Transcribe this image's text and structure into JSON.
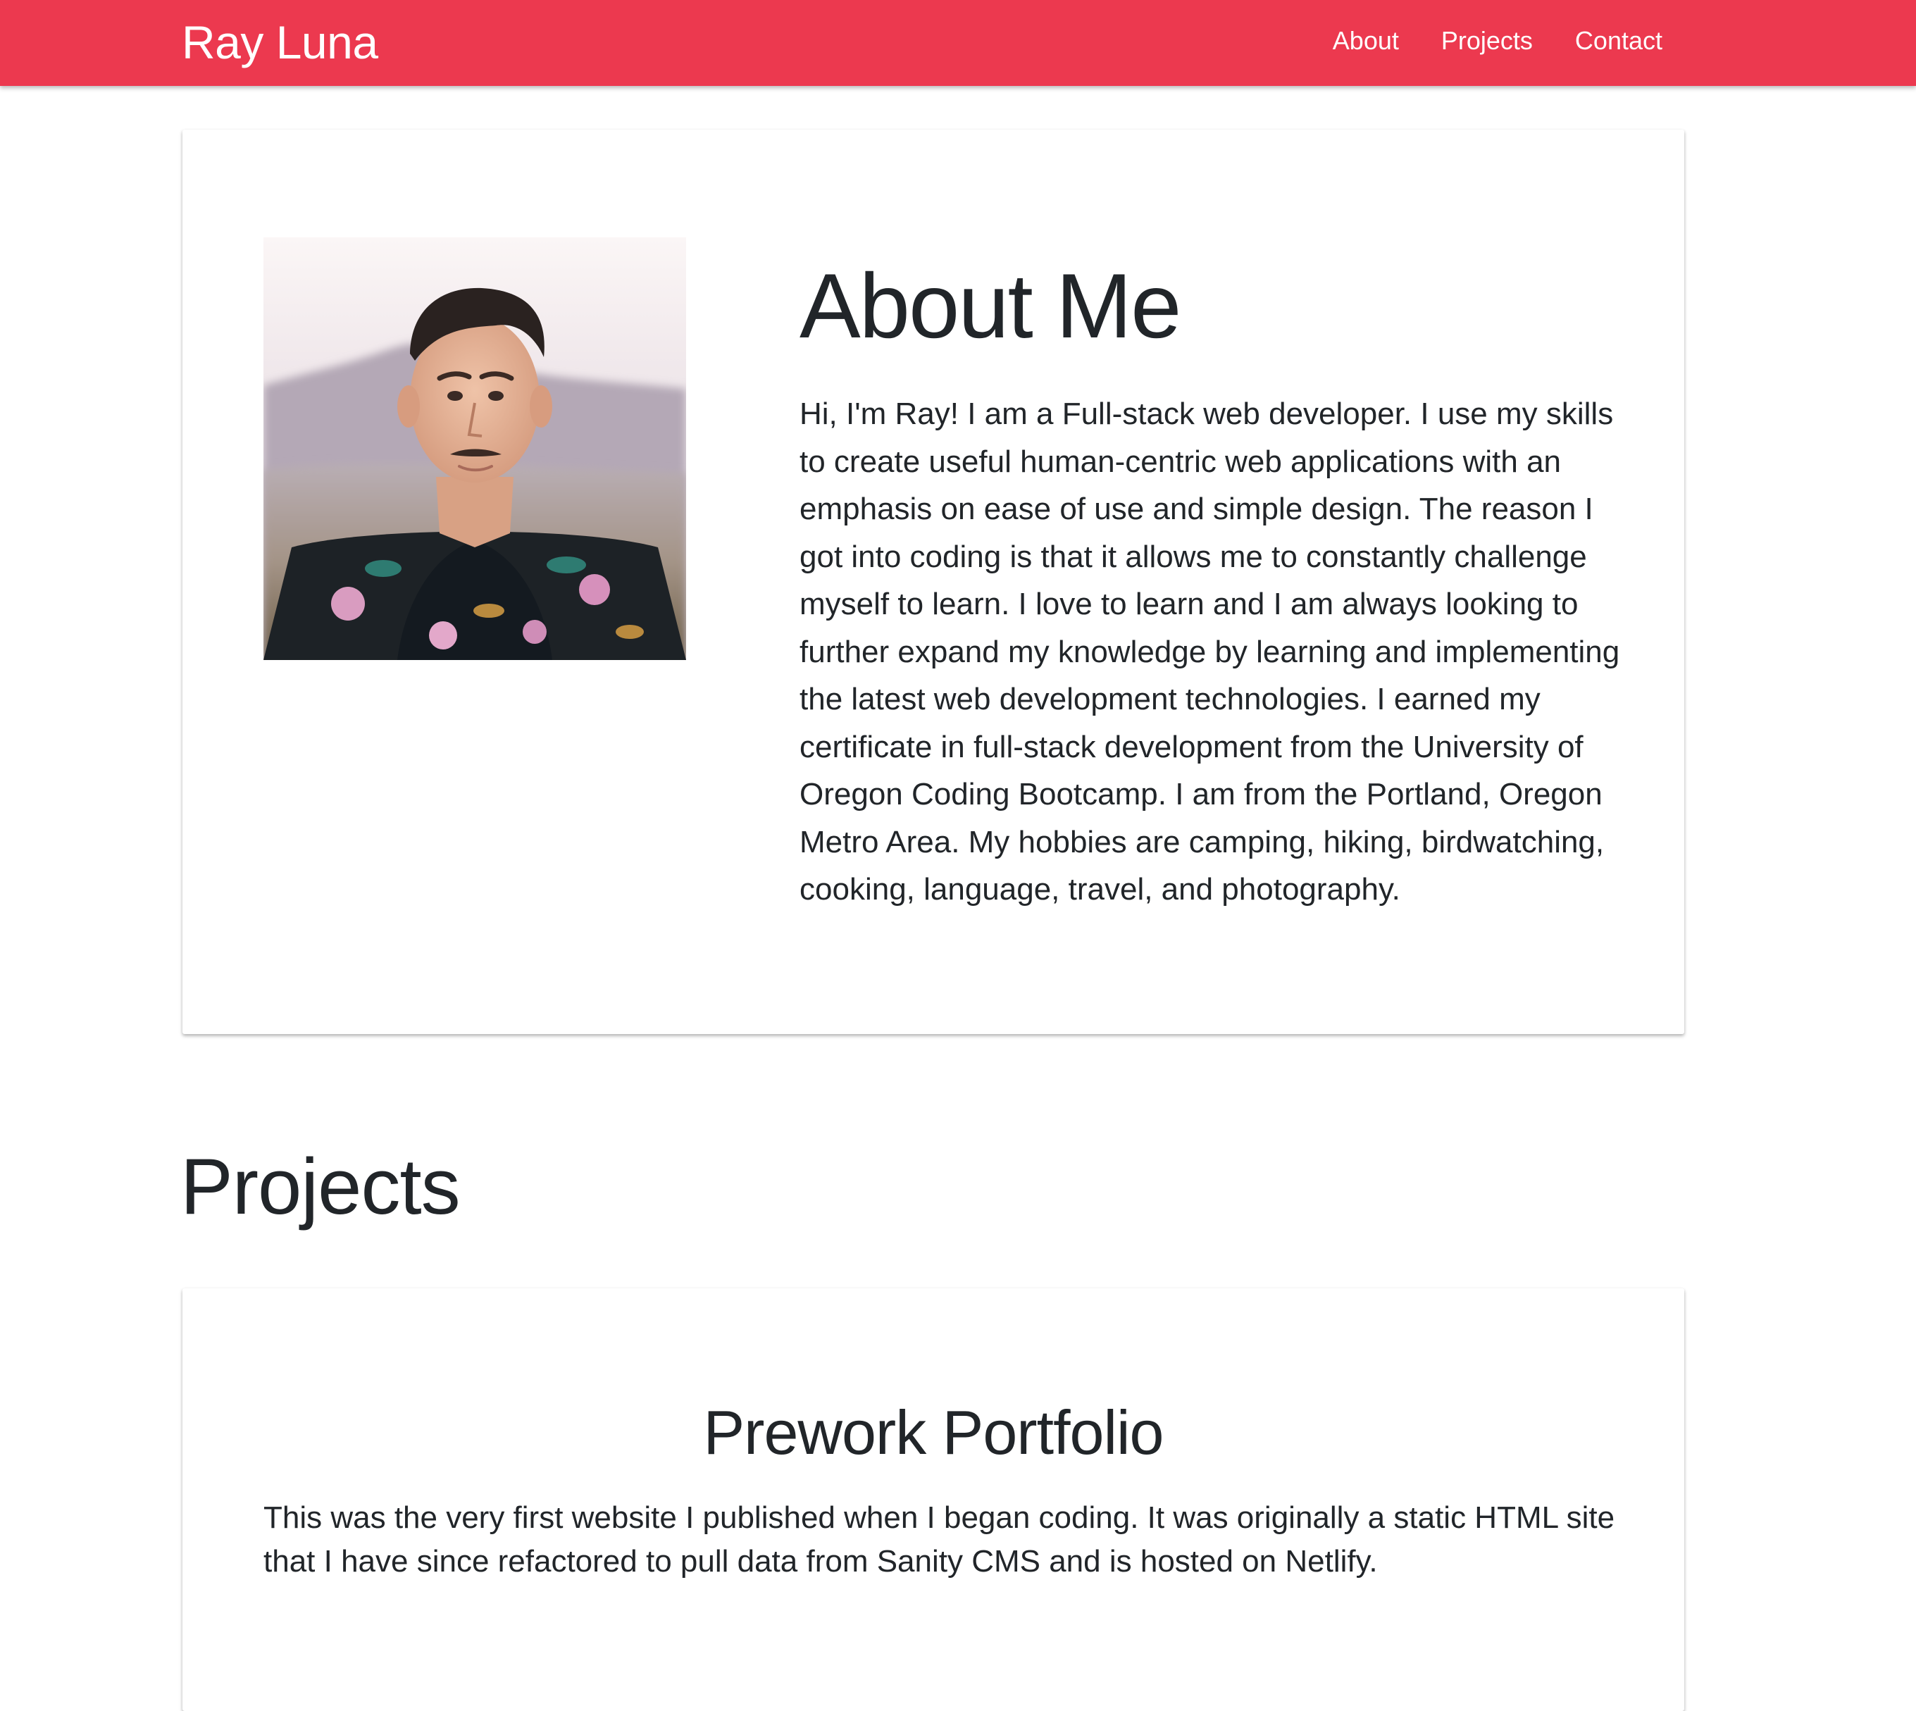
{
  "navbar": {
    "brand": "Ray Luna",
    "links": [
      "About",
      "Projects",
      "Contact"
    ],
    "color": "#ec394f"
  },
  "about": {
    "title": "About Me",
    "photo_icon": "portrait-photo",
    "text": "Hi, I'm Ray! I am a Full-stack web developer. I use my skills to create useful human-centric web applications with an emphasis on ease of use and simple design. The reason I got into coding is that it allows me to constantly challenge myself to learn. I love to learn and I am always looking to further expand my knowledge by learning and implementing the latest web development technologies. I earned my certificate in full-stack development from the University of Oregon Coding Bootcamp. I am from the Portland, Oregon Metro Area. My hobbies are camping, hiking, birdwatching, cooking, language, travel, and photography."
  },
  "projects": {
    "title": "Projects",
    "items": [
      {
        "title": "Prework Portfolio",
        "description": "This was the very first website I published when I began coding. It was originally a static HTML site that I have since refactored to pull data from Sanity CMS and is hosted on Netlify."
      }
    ]
  }
}
